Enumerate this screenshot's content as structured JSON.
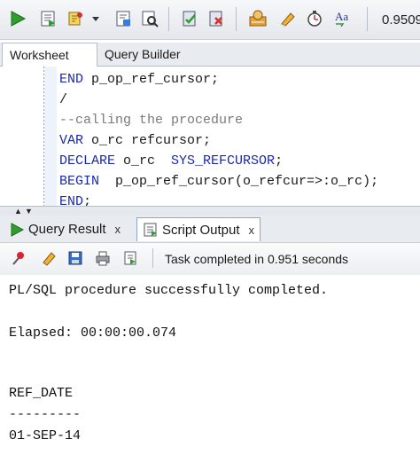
{
  "toolbar": {
    "buttons": [
      "run-statement-icon",
      "run-script-icon",
      "autotrace-icon",
      "dropdown-arrow-icon",
      "explain-plan-icon",
      "sql-tuning-icon",
      "commit-icon",
      "rollback-icon",
      "sql-history-icon",
      "clear-icon",
      "unshared-worksheet-icon",
      "format-case-icon"
    ],
    "elapsed_time": "0.9509"
  },
  "worksheet_tabs": [
    {
      "label": "Worksheet",
      "active": true
    },
    {
      "label": "Query Builder",
      "active": false
    }
  ],
  "editor": {
    "lines": [
      {
        "kw": "END",
        "rest": " p_op_ref_cursor;"
      },
      {
        "kw": "",
        "rest": "/"
      },
      {
        "comment": "--calling the procedure"
      },
      {
        "kw": "VAR",
        "rest": " o_rc refcursor;"
      },
      {
        "kw": "DECLARE",
        "rest": " o_rc  ",
        "kw2": "SYS_REFCURSOR",
        "rest2": ";"
      },
      {
        "kw": "BEGIN",
        "rest": "  p_op_ref_cursor(o_refcur=>:o_rc);"
      },
      {
        "kw": "END",
        "rest": ";"
      }
    ]
  },
  "output_tabs": [
    {
      "label": "Query Result",
      "close": "x",
      "active": false,
      "icon": "play-green-icon"
    },
    {
      "label": "Script Output",
      "close": "x",
      "active": true,
      "icon": "script-icon"
    }
  ],
  "output_toolbar": {
    "buttons": [
      "pin-icon",
      "eraser-icon",
      "save-icon",
      "print-icon",
      "open-file-icon"
    ],
    "status": "Task completed in 0.951 seconds"
  },
  "output": {
    "lines": [
      "PL/SQL procedure successfully completed.",
      "",
      "Elapsed: 00:00:00.074",
      "",
      "",
      "REF_DATE",
      "---------",
      "01-SEP-14"
    ]
  },
  "colors": {
    "keyword": "#1b2aa8",
    "comment": "#7a7a7a",
    "run_green": "#2f9e2f"
  }
}
